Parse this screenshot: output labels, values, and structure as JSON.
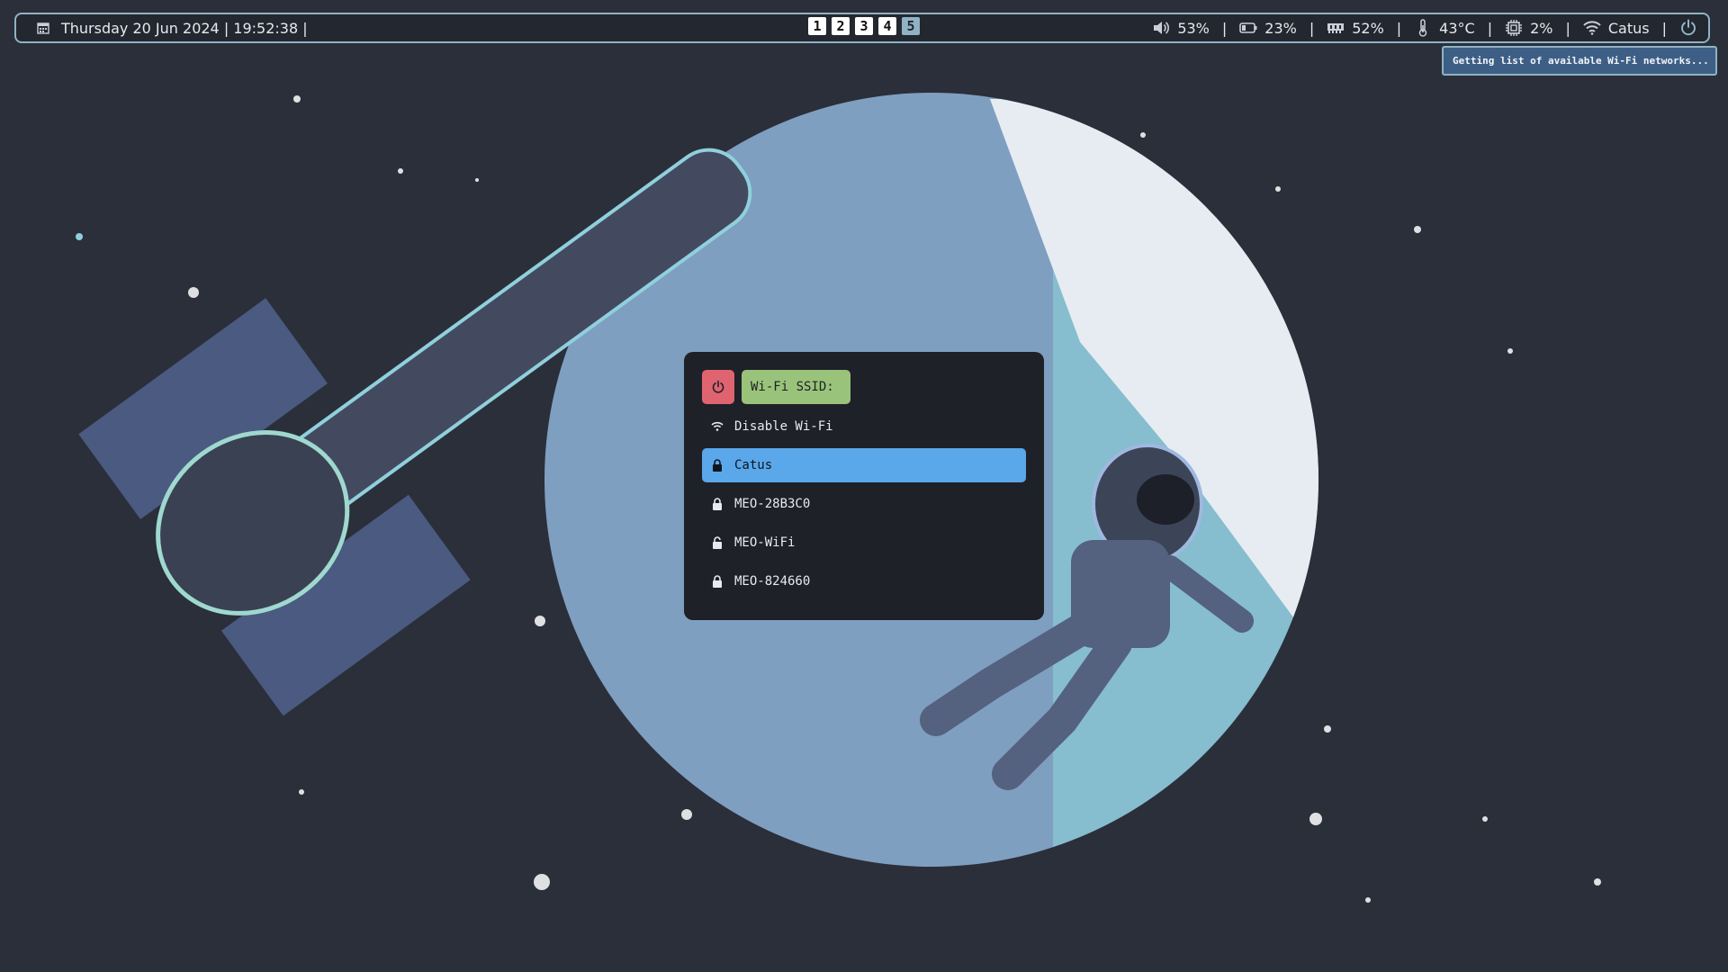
{
  "bar": {
    "calendar_icon": "calendar-icon",
    "datetime": "Thursday  20 Jun 2024 | 19:52:38 |",
    "workspaces": [
      {
        "label": "1",
        "active": false
      },
      {
        "label": "2",
        "active": false
      },
      {
        "label": "3",
        "active": false
      },
      {
        "label": "4",
        "active": false
      },
      {
        "label": "5",
        "active": true
      }
    ],
    "volume": {
      "icon": "speaker-icon",
      "value": "53%"
    },
    "battery": {
      "icon": "battery-icon",
      "value": "23%"
    },
    "memory": {
      "icon": "memory-icon",
      "value": "52%"
    },
    "temperature": {
      "icon": "thermometer-icon",
      "value": "43°C"
    },
    "cpu": {
      "icon": "cpu-icon",
      "value": "2%"
    },
    "network": {
      "icon": "wifi-icon",
      "value": "Catus"
    },
    "separator": "|",
    "power_icon": "power-icon"
  },
  "notification": {
    "text": "Getting list of available Wi-Fi networks..."
  },
  "wifi_menu": {
    "prompt": "Wi-Fi SSID:",
    "toggle_label": "Disable Wi-Fi",
    "networks": [
      {
        "ssid": "Catus",
        "icon": "lock-icon",
        "selected": true
      },
      {
        "ssid": "MEO-28B3C0",
        "icon": "lock-icon",
        "selected": false
      },
      {
        "ssid": "MEO-WiFi",
        "icon": "unlock-icon",
        "selected": false
      },
      {
        "ssid": "MEO-824660",
        "icon": "lock-icon",
        "selected": false
      }
    ]
  },
  "colors": {
    "bar_border": "#8fb3c4",
    "power_button": "#e06470",
    "prompt_bg": "#99c37a",
    "selection": "#5aa7ea",
    "notification_bg": "#3d5f85"
  }
}
